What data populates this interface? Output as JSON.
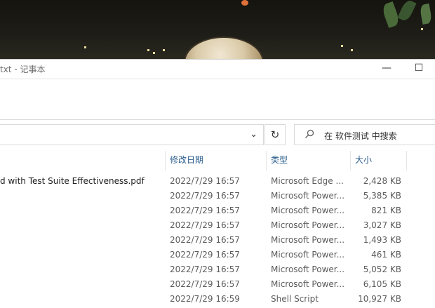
{
  "notepad": {
    "title": "txt - 记事本",
    "minimize_glyph": "—",
    "maximize_glyph": "☐"
  },
  "explorer": {
    "refresh_glyph": "↻",
    "dropdown_glyph": "⌄",
    "search_placeholder": "在 软件测试 中搜索",
    "columns": {
      "date": "修改日期",
      "type": "类型",
      "size": "大小"
    },
    "files": [
      {
        "name": "d with Test Suite Effectiveness.pdf",
        "date": "2022/7/29 16:57",
        "type": "Microsoft Edge ...",
        "size": "2,428 KB"
      },
      {
        "name": "",
        "date": "2022/7/29 16:57",
        "type": "Microsoft Power...",
        "size": "5,385 KB"
      },
      {
        "name": "",
        "date": "2022/7/29 16:57",
        "type": "Microsoft Power...",
        "size": "821 KB"
      },
      {
        "name": "",
        "date": "2022/7/29 16:57",
        "type": "Microsoft Power...",
        "size": "3,027 KB"
      },
      {
        "name": "",
        "date": "2022/7/29 16:57",
        "type": "Microsoft Power...",
        "size": "1,493 KB"
      },
      {
        "name": "",
        "date": "2022/7/29 16:57",
        "type": "Microsoft Power...",
        "size": "461 KB"
      },
      {
        "name": "",
        "date": "2022/7/29 16:57",
        "type": "Microsoft Power...",
        "size": "5,052 KB"
      },
      {
        "name": "",
        "date": "2022/7/29 16:57",
        "type": "Microsoft Power...",
        "size": "6,105 KB"
      },
      {
        "name": "",
        "date": "2022/7/29 16:59",
        "type": "Shell Script",
        "size": "10,927 KB"
      }
    ]
  },
  "icons": {
    "search": "search-icon",
    "refresh": "refresh-icon",
    "dropdown": "chevron-down-icon",
    "minimize": "minimize-icon",
    "maximize": "maximize-icon"
  }
}
